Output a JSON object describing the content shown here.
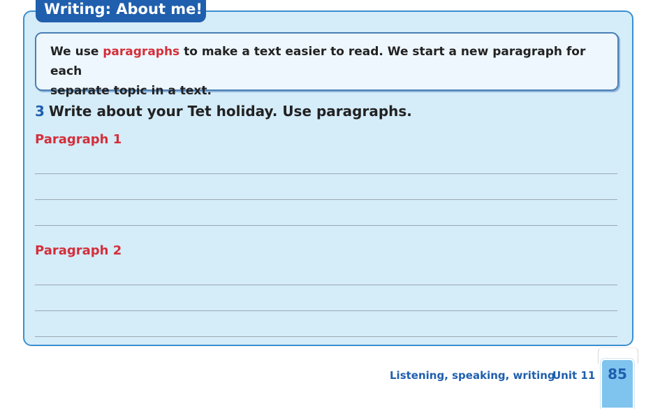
{
  "header": {
    "title": "Writing: About me!"
  },
  "info_box": {
    "text_before": "We use ",
    "highlight": "paragraphs",
    "text_after_line1": " to make a text easier to read. We start a new paragraph for each",
    "line2": "separate topic in a text."
  },
  "task": {
    "number": "3",
    "instruction": "Write about your Tet holiday. Use paragraphs."
  },
  "paragraphs": [
    {
      "label": "Paragraph 1"
    },
    {
      "label": "Paragraph 2"
    }
  ],
  "footer": {
    "section": "Listening, speaking, writing",
    "unit": "Unit 11",
    "page_number": "85"
  },
  "colors": {
    "accent_blue": "#1f5fae",
    "highlight_red": "#d32f3a",
    "panel_bg": "#d5ecf9"
  }
}
